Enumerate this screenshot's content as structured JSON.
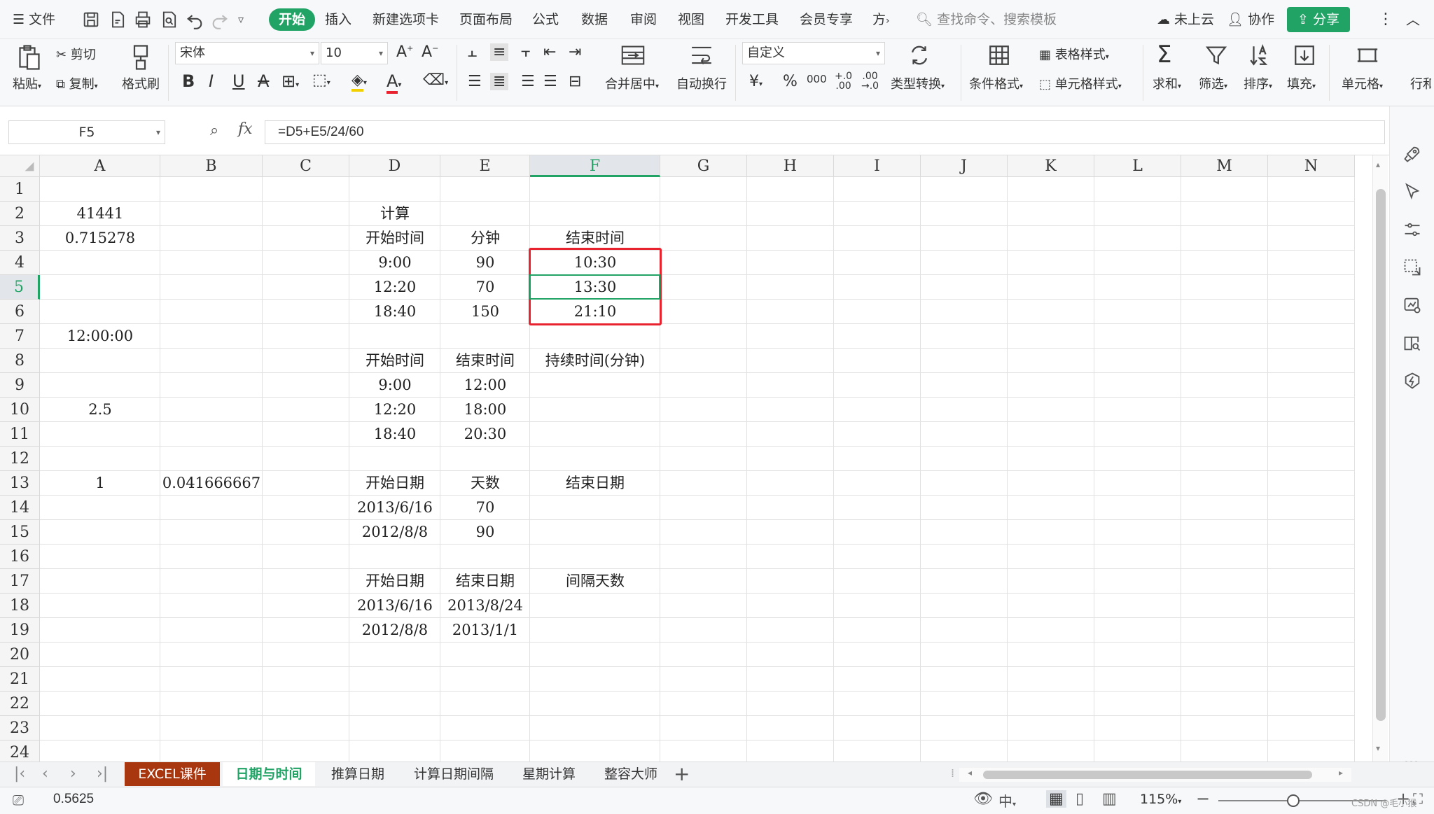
{
  "menu": {
    "file": "文件",
    "tabs": [
      "开始",
      "插入",
      "新建选项卡",
      "页面布局",
      "公式",
      "数据",
      "审阅",
      "视图",
      "开发工具",
      "会员专享",
      "方"
    ],
    "active_tab": "开始",
    "search_placeholder": "查找命令、搜索模板",
    "cloud": "未上云",
    "collab": "协作",
    "share": "分享"
  },
  "ribbon": {
    "paste": "粘贴",
    "cut": "剪切",
    "copy": "复制",
    "format_painter": "格式刷",
    "font_name": "宋体",
    "font_size": "10",
    "merge_center": "合并居中",
    "wrap_text": "自动换行",
    "number_format": "自定义",
    "type_convert": "类型转换",
    "cond_format": "条件格式",
    "table_style": "表格样式",
    "cell_style": "单元格样式",
    "sum": "求和",
    "filter": "筛选",
    "sort": "排序",
    "fill": "填充",
    "cell": "单元格",
    "row_col": "行和"
  },
  "formula_bar": {
    "name_box": "F5",
    "fx": "fx",
    "formula": "=D5+E5/24/60"
  },
  "grid": {
    "columns": [
      "A",
      "B",
      "C",
      "D",
      "E",
      "F",
      "G",
      "H",
      "I",
      "J",
      "K",
      "L",
      "M",
      "N"
    ],
    "selected_column": "F",
    "selected_row": "5",
    "rows": [
      "1",
      "2",
      "3",
      "4",
      "5",
      "6",
      "7",
      "8",
      "9",
      "10",
      "11",
      "12",
      "13",
      "14",
      "15",
      "16",
      "17",
      "18",
      "19",
      "20",
      "21",
      "22",
      "23",
      "24"
    ],
    "cells": {
      "A2": "41441",
      "A3": "0.715278",
      "A7": "12:00:00",
      "A10": "2.5",
      "A13": "1",
      "B13": "0.041666667",
      "D2": "计算",
      "D3": "开始时间",
      "E3": "分钟",
      "F3": "结束时间",
      "D4": "9:00",
      "E4": "90",
      "F4": "10:30",
      "D5": "12:20",
      "E5": "70",
      "F5": "13:30",
      "D6": "18:40",
      "E6": "150",
      "F6": "21:10",
      "D8": "开始时间",
      "E8": "结束时间",
      "F8": "持续时间(分钟)",
      "D9": "9:00",
      "E9": "12:00",
      "D10": "12:20",
      "E10": "18:00",
      "D11": "18:40",
      "E11": "20:30",
      "D13": "开始日期",
      "E13": "天数",
      "F13": "结束日期",
      "D14": "2013/6/16",
      "E14": "70",
      "D15": "2012/8/8",
      "E15": "90",
      "D17": "开始日期",
      "E17": "结束日期",
      "F17": "间隔天数",
      "D18": "2013/6/16",
      "E18": "2013/8/24",
      "D19": "2012/8/8",
      "E19": "2013/1/1"
    }
  },
  "sheets": {
    "tabs": [
      "EXCEL课件",
      "日期与时间",
      "推算日期",
      "计算日期间隔",
      "星期计算",
      "整容大师"
    ],
    "active": "日期与时间"
  },
  "status": {
    "value": "0.5625",
    "zoom": "115%",
    "watermark": "CSDN @毛小猴"
  },
  "colors": {
    "accent": "#21a366",
    "highlight_box": "#e8222e",
    "first_tab": "#a8360e"
  }
}
